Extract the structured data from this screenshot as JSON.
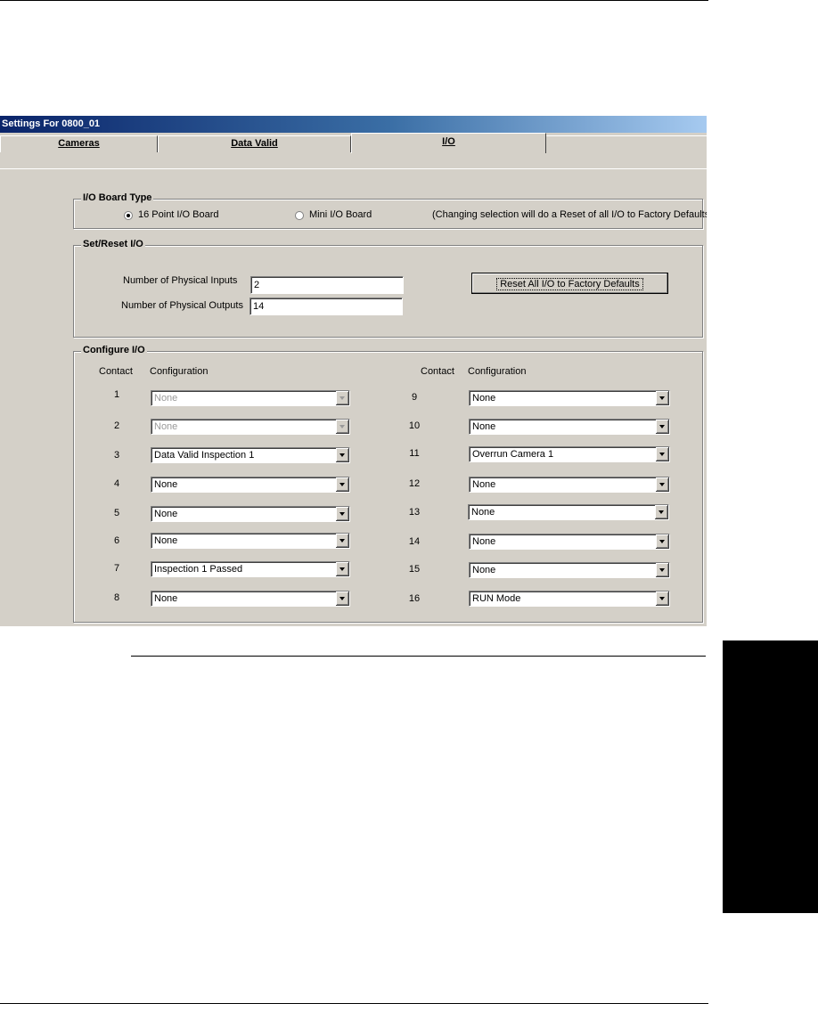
{
  "window": {
    "title": "Settings For 0800_01"
  },
  "tabs": [
    {
      "label": "Cameras"
    },
    {
      "label": "Data Valid"
    },
    {
      "label": "I/O"
    }
  ],
  "board_type": {
    "title": "I/O Board Type",
    "option_16": "16 Point I/O Board",
    "option_mini": "Mini I/O Board",
    "selected": "16 Point I/O Board",
    "note": "(Changing selection will do a Reset of all I/O to Factory Defaults)"
  },
  "set_reset": {
    "title": "Set/Reset I/O",
    "inputs_label": "Number of Physical Inputs",
    "inputs_value": "2",
    "outputs_label": "Number of Physical Outputs",
    "outputs_value": "14",
    "reset_button": "Reset All I/O to Factory Defaults"
  },
  "configure": {
    "title": "Configure I/O",
    "contact_header": "Contact",
    "config_header": "Configuration",
    "left": [
      {
        "contact": "1",
        "value": "None",
        "disabled": true
      },
      {
        "contact": "2",
        "value": "None",
        "disabled": true
      },
      {
        "contact": "3",
        "value": "Data Valid Inspection 1"
      },
      {
        "contact": "4",
        "value": "None"
      },
      {
        "contact": "5",
        "value": "None"
      },
      {
        "contact": "6",
        "value": "None"
      },
      {
        "contact": "7",
        "value": "Inspection 1 Passed"
      },
      {
        "contact": "8",
        "value": "None"
      }
    ],
    "right": [
      {
        "contact": "9",
        "value": "None"
      },
      {
        "contact": "10",
        "value": "None"
      },
      {
        "contact": "11",
        "value": "Overrun Camera 1"
      },
      {
        "contact": "12",
        "value": "None"
      },
      {
        "contact": "13",
        "value": "None"
      },
      {
        "contact": "14",
        "value": "None"
      },
      {
        "contact": "15",
        "value": "None"
      },
      {
        "contact": "16",
        "value": "RUN Mode"
      }
    ]
  }
}
